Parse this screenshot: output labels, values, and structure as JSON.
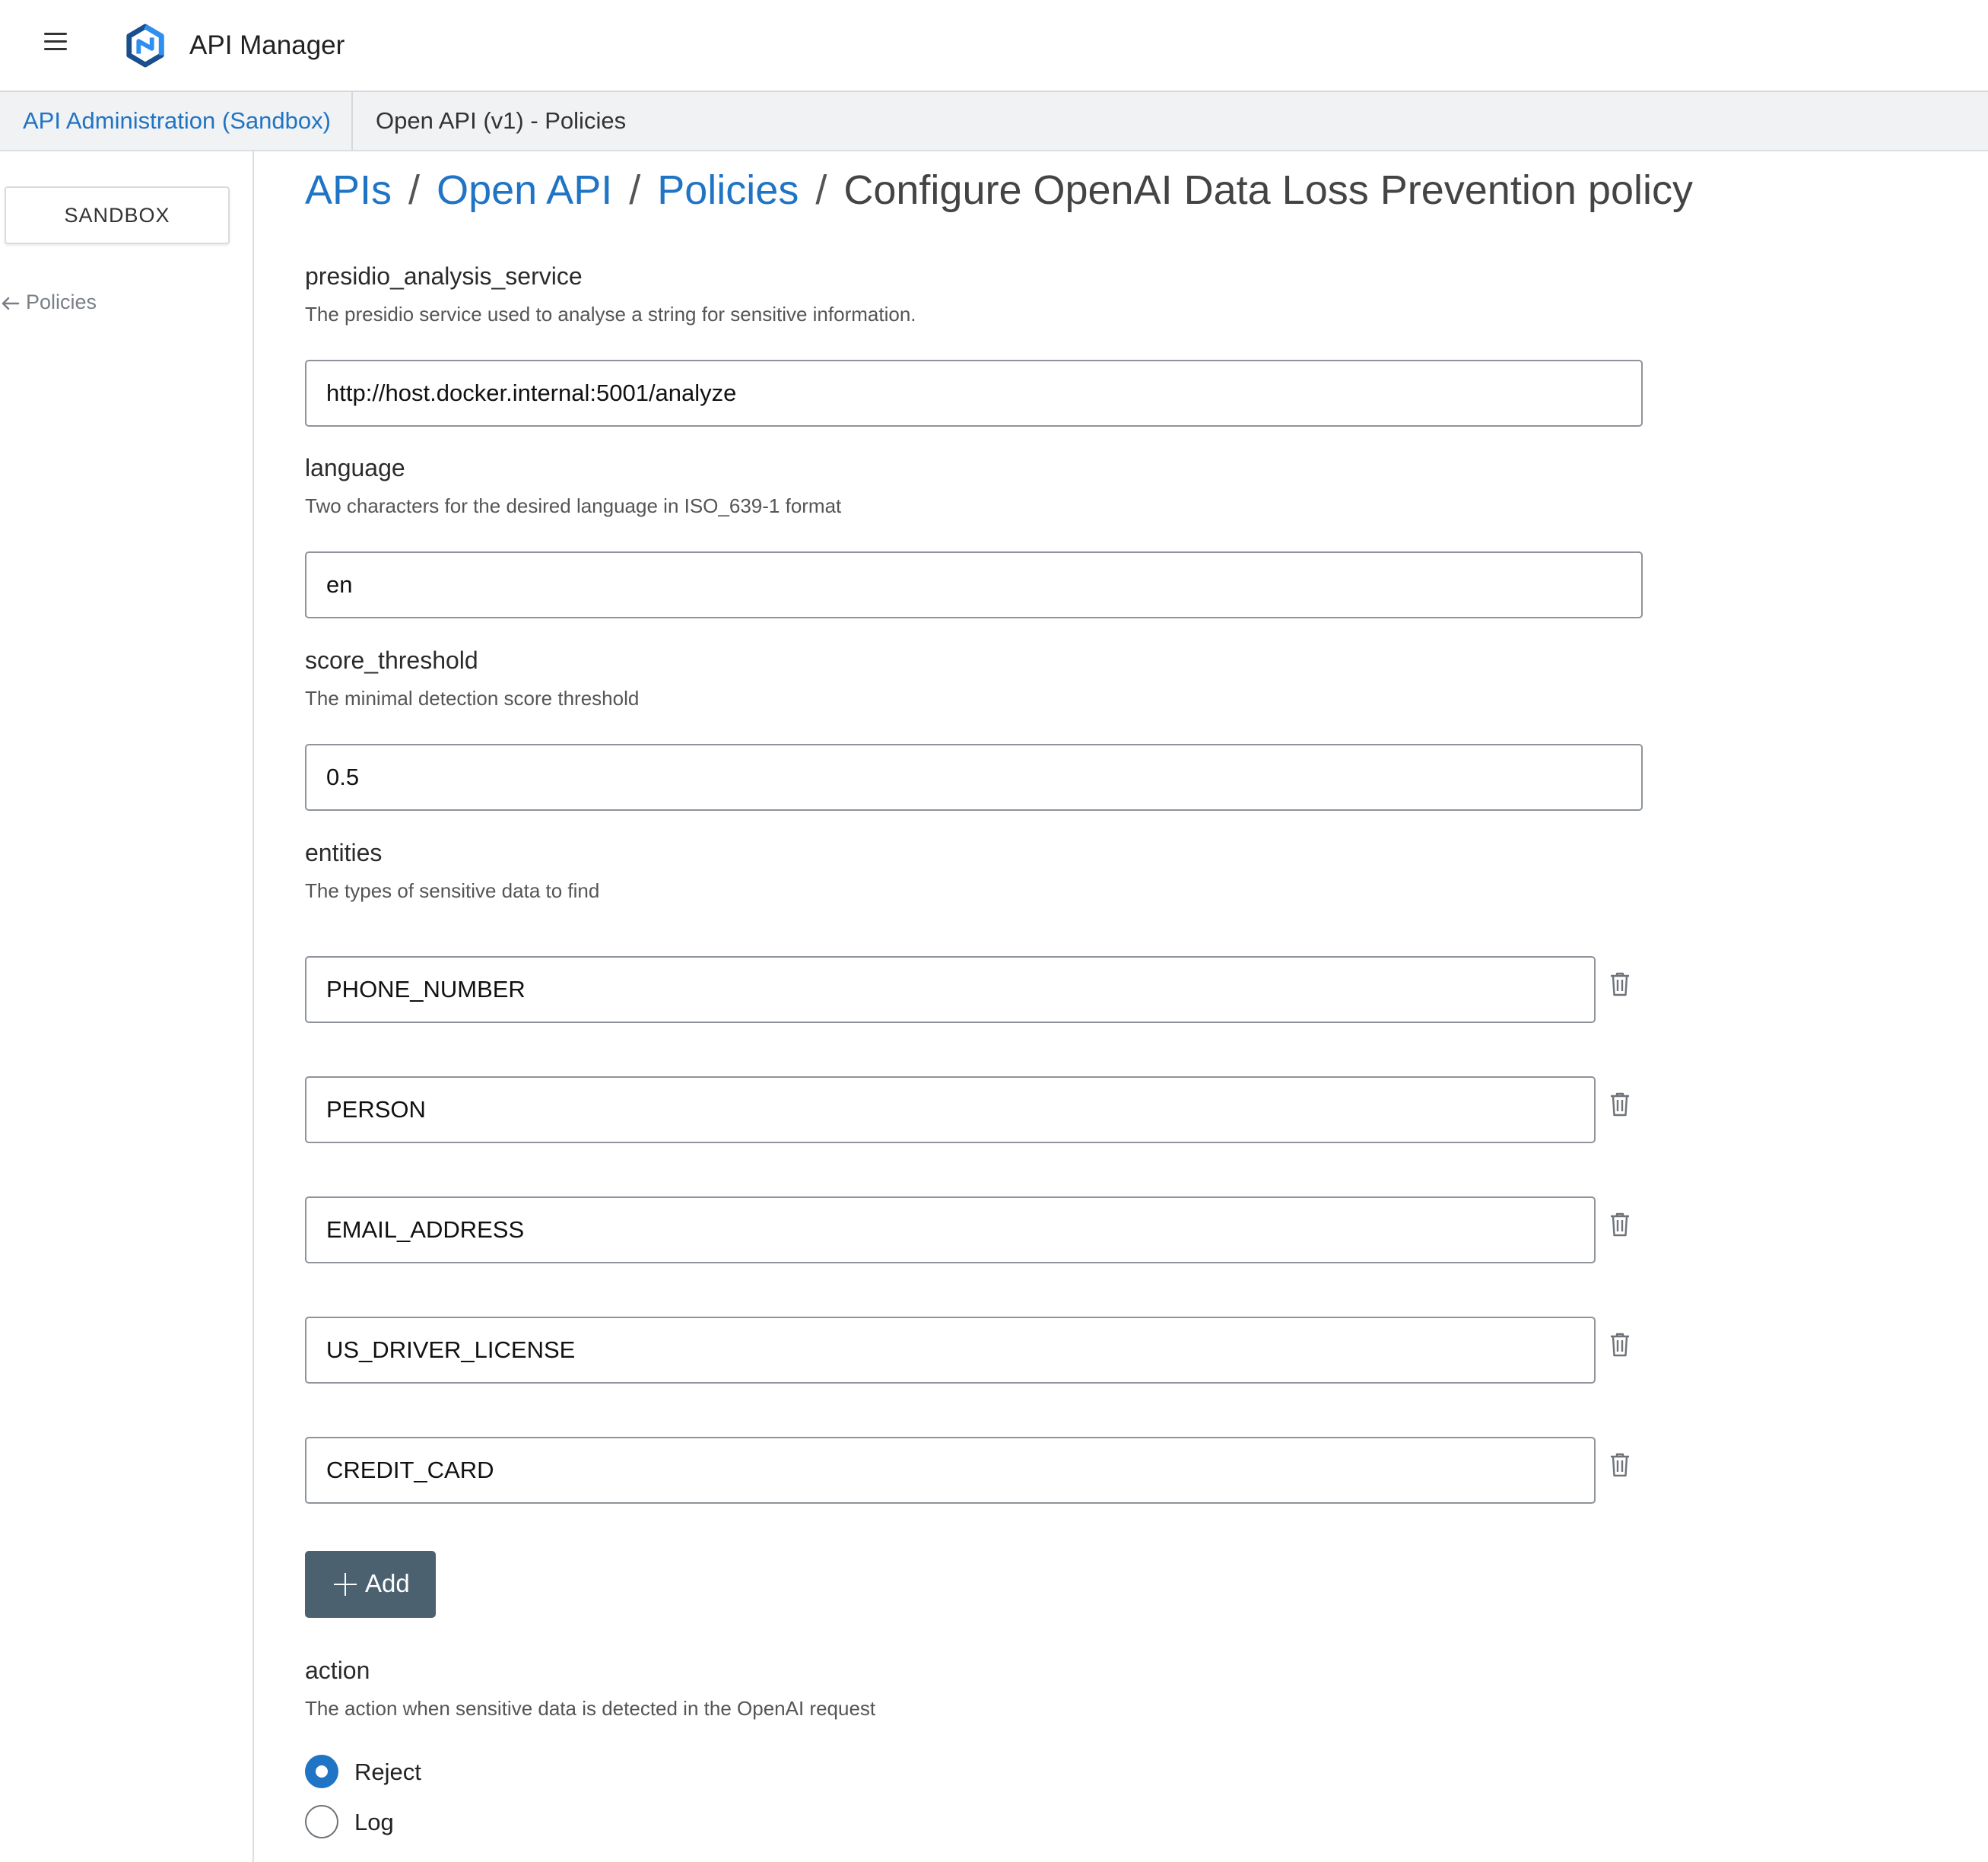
{
  "header": {
    "menu_icon": "hamburger-menu-icon",
    "logo_icon": "api-manager-logo",
    "title": "API Manager"
  },
  "tabs": [
    {
      "label": "API Administration (Sandbox)",
      "active": false
    },
    {
      "label": "Open API (v1) - Policies",
      "active": true
    }
  ],
  "sidebar": {
    "environment_button": "SANDBOX",
    "back_link": "Policies",
    "back_icon": "arrow-left-icon"
  },
  "breadcrumb": {
    "items": [
      "APIs",
      "Open API",
      "Policies"
    ],
    "separator": "/",
    "current": "Configure OpenAI Data Loss Prevention policy"
  },
  "form": {
    "presidio": {
      "label": "presidio_analysis_service",
      "description": "The presidio service used to analyse a string for sensitive information.",
      "value": "http://host.docker.internal:5001/analyze"
    },
    "language": {
      "label": "language",
      "description": "Two characters for the desired language in ISO_639-1 format",
      "value": "en"
    },
    "score_threshold": {
      "label": "score_threshold",
      "description": "The minimal detection score threshold",
      "value": "0.5"
    },
    "entities": {
      "label": "entities",
      "description": "The types of sensitive data to find",
      "values": [
        "PHONE_NUMBER",
        "PERSON",
        "EMAIL_ADDRESS",
        "US_DRIVER_LICENSE",
        "CREDIT_CARD"
      ],
      "delete_icon": "trash-icon",
      "add_label": "Add",
      "add_icon": "plus-icon"
    },
    "action": {
      "label": "action",
      "description": "The action when sensitive data is detected in the OpenAI request",
      "options": [
        {
          "label": "Reject",
          "selected": true
        },
        {
          "label": "Log",
          "selected": false
        }
      ]
    }
  },
  "colors": {
    "accent": "#1f74c5",
    "add_button": "#4b6170",
    "logo_dark": "#1a4e8f",
    "logo_light": "#2f8ff0"
  }
}
